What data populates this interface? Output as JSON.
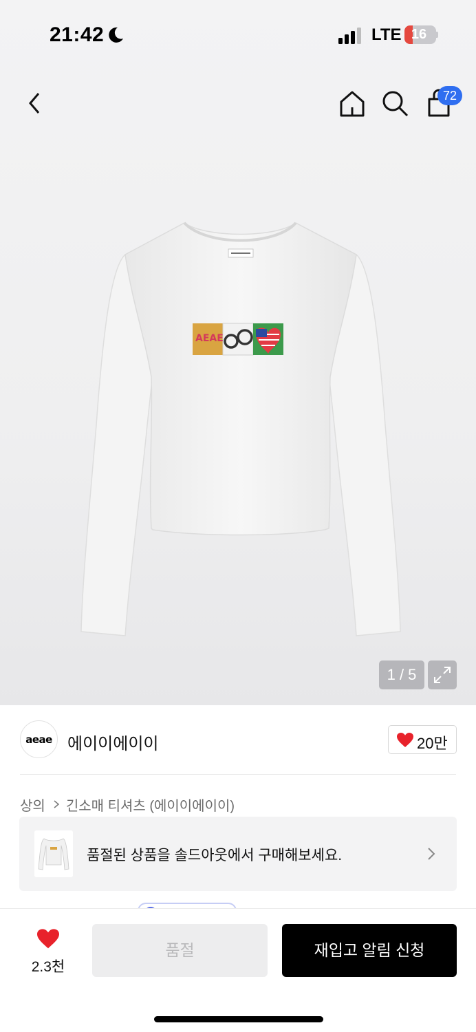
{
  "status_bar": {
    "time": "21:42",
    "network": "LTE",
    "battery": "16",
    "icons": [
      "moon-icon",
      "signal-icon",
      "battery-icon"
    ]
  },
  "nav": {
    "icons": [
      "back-icon",
      "home-icon",
      "search-icon",
      "cart-icon"
    ],
    "cart_count": "72"
  },
  "gallery": {
    "pager": "1 / 5",
    "expand_icon": "expand-icon"
  },
  "brand": {
    "logo_text": "aeae",
    "name": "에이이에이이",
    "like_count": "20만",
    "like_icon": "heart-icon",
    "heart_color": "#e8222b"
  },
  "breadcrumb": {
    "category": "상의",
    "subcategory": "긴소매 티셔츠 (에이이에이이)"
  },
  "soldout_banner": {
    "text": "품절된 상품을 솔드아웃에서 구매해보세요."
  },
  "bottom_bar": {
    "wish_count": "2.3천",
    "soldout_label": "품절",
    "restock_label": "재입고 알림 신청"
  }
}
